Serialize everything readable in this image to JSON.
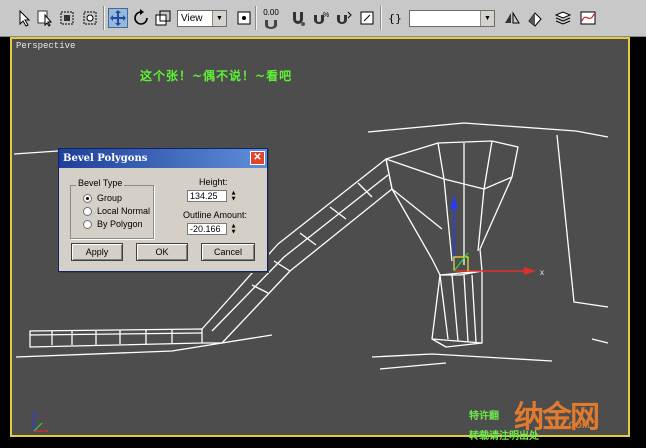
{
  "toolbar": {
    "view_combo": "View",
    "snap_value": "0.00",
    "selection_set_combo": "",
    "icons": [
      "select-arrow-icon",
      "select-by-name-icon",
      "rect-region-icon",
      "window-crossing-icon",
      "move-icon",
      "rotate-icon",
      "view-combo",
      "pivot-icon",
      "snap-icon",
      "angle-snap-icon",
      "percent-snap-icon",
      "spinner-snap-icon",
      "edit-named-sel-icon",
      "mirror-icon",
      "align-icon",
      "layers-icon"
    ]
  },
  "viewport": {
    "label": "Perspective",
    "caption": "这个张！~偶不说！~看吧",
    "gizmo_x_label": "x",
    "border_color": "#e6c93e"
  },
  "dialog": {
    "title": "Bevel Polygons",
    "close_label": "✕",
    "group_label": "Bevel Type",
    "options": [
      {
        "label": "Group",
        "selected": true
      },
      {
        "label": "Local Normal",
        "selected": false
      },
      {
        "label": "By Polygon",
        "selected": false
      }
    ],
    "height_label": "Height:",
    "height_value": "134.25",
    "outline_label": "Outline Amount:",
    "outline_value": "-20.166",
    "apply_label": "Apply",
    "ok_label": "OK",
    "cancel_label": "Cancel"
  },
  "watermark": {
    "line1": "特许翻",
    "line2": "转载请注明出处",
    "logo": "纳金网",
    "logo_suffix": ".COM"
  },
  "colors": {
    "caption": "#5ef036",
    "wire": "#ffffff",
    "gizmo_x": "#e0302a",
    "gizmo_y": "#3ad33a",
    "gizmo_z": "#2b3cf0"
  }
}
